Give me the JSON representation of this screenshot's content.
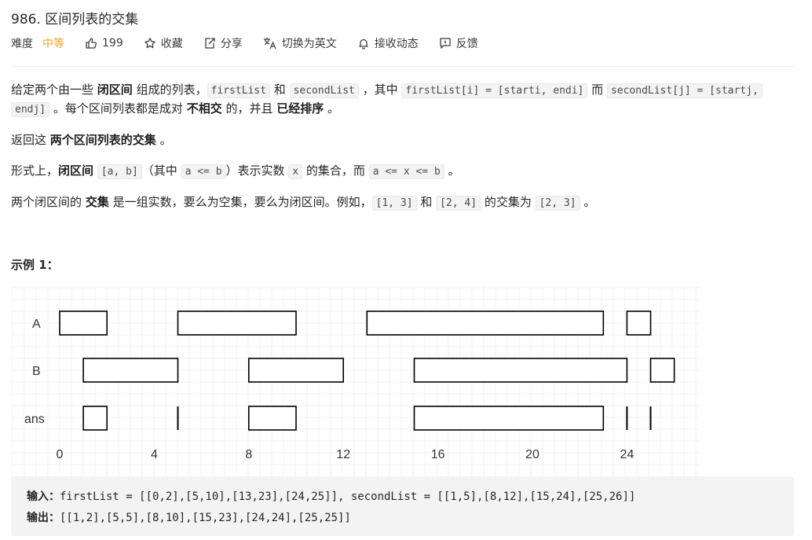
{
  "problem": {
    "title": "986. 区间列表的交集",
    "difficulty_label": "难度",
    "difficulty": "中等",
    "likes": "199",
    "collect": "收藏",
    "share": "分享",
    "translate": "切换为英文",
    "subscribe": "接收动态",
    "feedback": "反馈"
  },
  "description": {
    "p1": {
      "t1": "给定两个由一些 ",
      "b1": "闭区间",
      "t2": " 组成的列表，",
      "c1": "firstList",
      "t3": " 和 ",
      "c2": "secondList",
      "t4": " ，其中 ",
      "c3": "firstList[i] = [starti, endi]",
      "t5": " 而 ",
      "c4": "secondList[j] = [startj,",
      "c5": "endj]",
      "t6": " 。每个区间列表都是成对 ",
      "b2": "不相交",
      "t7": " 的，并且 ",
      "b3": "已经排序",
      "t8": " 。"
    },
    "p2": {
      "t1": "返回这 ",
      "b1": "两个区间列表的交集",
      "t2": " 。"
    },
    "p3": {
      "t1": "形式上，",
      "b1": "闭区间",
      "c1": "[a, b]",
      "t2": "（其中 ",
      "c2": "a <= b",
      "t3": "）表示实数 ",
      "c3": "x",
      "t4": " 的集合，而 ",
      "c4": "a <= x <= b",
      "t5": " 。"
    },
    "p4": {
      "t1": "两个闭区间的 ",
      "b1": "交集",
      "t2": " 是一组实数，要么为空集，要么为闭区间。例如，",
      "c1": "[1, 3]",
      "t3": " 和 ",
      "c2": "[2, 4]",
      "t4": " 的交集为 ",
      "c3": "[2, 3]",
      "t5": " 。"
    }
  },
  "example": {
    "title": "示例 1：",
    "input_label": "输入：",
    "input": "firstList = [[0,2],[5,10],[13,23],[24,25]], secondList = [[1,5],[8,12],[15,24],[25,26]]",
    "output_label": "输出：",
    "output": "[[1,2],[5,5],[8,10],[15,23],[24,24],[25,25]]"
  },
  "chart_data": {
    "type": "interval",
    "series": [
      {
        "name": "A",
        "intervals": [
          [
            0,
            2
          ],
          [
            5,
            10
          ],
          [
            13,
            23
          ],
          [
            24,
            25
          ]
        ]
      },
      {
        "name": "B",
        "intervals": [
          [
            1,
            5
          ],
          [
            8,
            12
          ],
          [
            15,
            24
          ],
          [
            25,
            26
          ]
        ]
      },
      {
        "name": "ans",
        "intervals": [
          [
            1,
            2
          ],
          [
            5,
            5
          ],
          [
            8,
            10
          ],
          [
            15,
            23
          ],
          [
            24,
            24
          ],
          [
            25,
            25
          ]
        ]
      }
    ],
    "x_ticks": [
      0,
      4,
      8,
      12,
      16,
      20,
      24
    ],
    "xlim": [
      -2,
      27
    ],
    "grid": true
  }
}
